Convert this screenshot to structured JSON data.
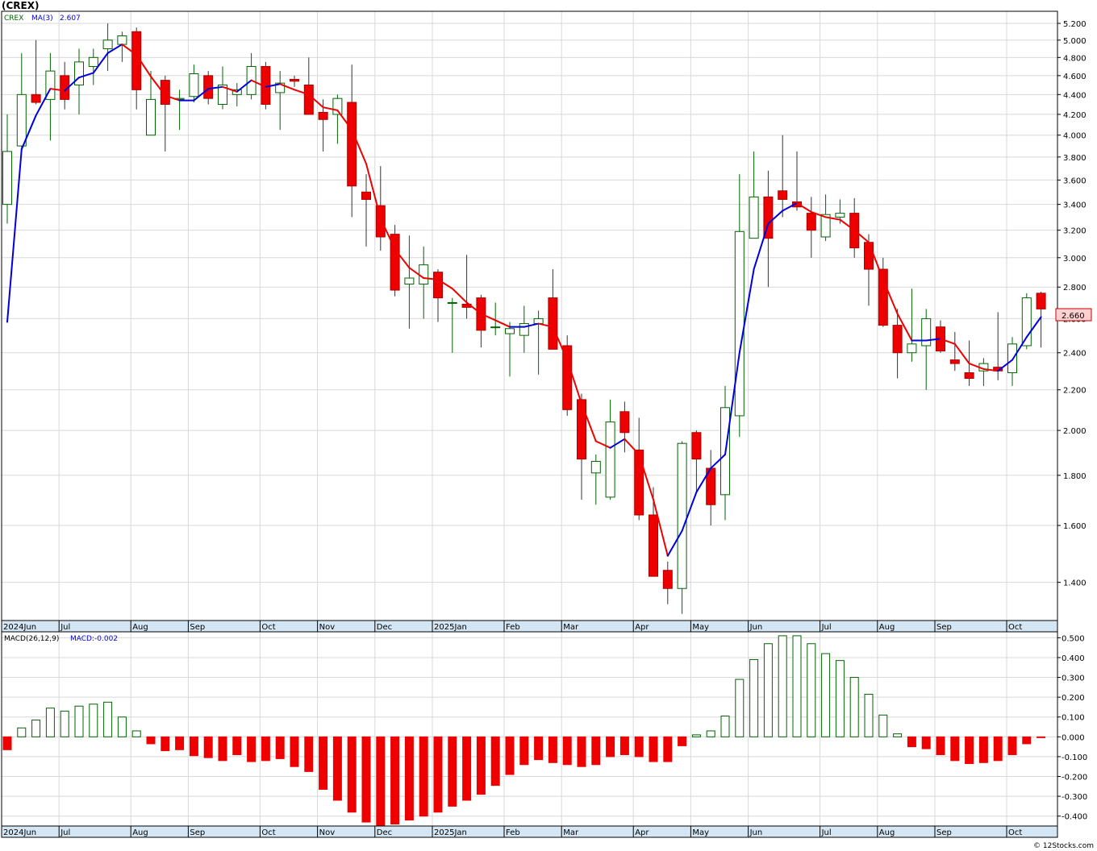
{
  "header": {
    "symbol_title": "(CREX)",
    "legend_symbol": "CREX",
    "legend_ma": "MA(3)",
    "legend_ma_value": "2.607",
    "macd_label": "MACD(26,12,9)",
    "macd_value_label": "MACD:-0.002",
    "watermark": "© 12Stocks.com",
    "last_price_tag": "2.660"
  },
  "colors": {
    "up_candle_fill": "#ffffff",
    "up_candle_stroke": "#006400",
    "down_candle_fill": "#ee0000",
    "down_candle_stroke": "#aa0000",
    "ma_rising": "#0000dd",
    "ma_falling": "#ee0000",
    "macd_positive": "#006400",
    "macd_negative": "#ee0000",
    "grid": "#d8d8d8",
    "axis_band": "#d4e6f4",
    "price_tag": "#ffd0d0"
  },
  "chart_data": [
    {
      "type": "candlestick",
      "title": "(CREX)",
      "scale": "log",
      "ylim": [
        1.28,
        5.35
      ],
      "yticks": [
        "1.400",
        "1.600",
        "1.800",
        "2.000",
        "2.200",
        "2.400",
        "2.600",
        "2.800",
        "3.000",
        "3.200",
        "3.400",
        "3.600",
        "3.800",
        "4.000",
        "4.200",
        "4.400",
        "4.600",
        "4.800",
        "5.000",
        "5.200"
      ],
      "xlabels": [
        {
          "label": "2024Jun",
          "i": 0
        },
        {
          "label": "Jul",
          "i": 4
        },
        {
          "label": "Aug",
          "i": 9
        },
        {
          "label": "Sep",
          "i": 13
        },
        {
          "label": "Oct",
          "i": 18
        },
        {
          "label": "Nov",
          "i": 22
        },
        {
          "label": "Dec",
          "i": 26
        },
        {
          "label": "2025Jan",
          "i": 30
        },
        {
          "label": "Feb",
          "i": 35
        },
        {
          "label": "Mar",
          "i": 39
        },
        {
          "label": "Apr",
          "i": 44
        },
        {
          "label": "May",
          "i": 48
        },
        {
          "label": "Jun",
          "i": 52
        },
        {
          "label": "Jul",
          "i": 57
        },
        {
          "label": "Aug",
          "i": 61
        },
        {
          "label": "Sep",
          "i": 65
        },
        {
          "label": "Oct",
          "i": 70
        }
      ],
      "ohlc": [
        [
          3.4,
          4.2,
          3.25,
          3.85
        ],
        [
          3.9,
          4.85,
          3.85,
          4.4
        ],
        [
          4.4,
          5.0,
          4.3,
          4.32
        ],
        [
          4.35,
          4.85,
          3.95,
          4.65
        ],
        [
          4.6,
          4.75,
          4.25,
          4.35
        ],
        [
          4.5,
          4.9,
          4.2,
          4.75
        ],
        [
          4.7,
          4.9,
          4.5,
          4.8
        ],
        [
          4.9,
          5.2,
          4.65,
          5.0
        ],
        [
          4.95,
          5.1,
          4.75,
          5.05
        ],
        [
          5.1,
          5.15,
          4.25,
          4.45
        ],
        [
          4.0,
          4.65,
          4.0,
          4.35
        ],
        [
          4.55,
          4.6,
          3.85,
          4.3
        ],
        [
          4.35,
          4.45,
          4.05,
          4.36
        ],
        [
          4.38,
          4.72,
          4.32,
          4.62
        ],
        [
          4.6,
          4.65,
          4.3,
          4.36
        ],
        [
          4.3,
          4.7,
          4.25,
          4.5
        ],
        [
          4.4,
          4.52,
          4.28,
          4.45
        ],
        [
          4.4,
          4.85,
          4.35,
          4.7
        ],
        [
          4.7,
          4.75,
          4.25,
          4.3
        ],
        [
          4.42,
          4.65,
          4.05,
          4.52
        ],
        [
          4.56,
          4.6,
          4.48,
          4.54
        ],
        [
          4.5,
          4.8,
          4.2,
          4.2
        ],
        [
          4.22,
          4.35,
          3.85,
          4.15
        ],
        [
          4.2,
          4.4,
          3.92,
          4.36
        ],
        [
          4.32,
          4.72,
          3.3,
          3.55
        ],
        [
          3.5,
          3.65,
          3.08,
          3.44
        ],
        [
          3.39,
          3.72,
          3.05,
          3.15
        ],
        [
          3.17,
          3.24,
          2.74,
          2.78
        ],
        [
          2.82,
          3.16,
          2.54,
          2.86
        ],
        [
          2.82,
          3.08,
          2.6,
          2.95
        ],
        [
          2.9,
          2.92,
          2.58,
          2.73
        ],
        [
          2.7,
          2.73,
          2.4,
          2.7
        ],
        [
          2.69,
          3.02,
          2.6,
          2.67
        ],
        [
          2.73,
          2.75,
          2.43,
          2.53
        ],
        [
          2.55,
          2.7,
          2.5,
          2.55
        ],
        [
          2.51,
          2.58,
          2.27,
          2.54
        ],
        [
          2.5,
          2.68,
          2.4,
          2.57
        ],
        [
          2.57,
          2.65,
          2.28,
          2.6
        ],
        [
          2.73,
          2.92,
          2.42,
          2.42
        ],
        [
          2.44,
          2.5,
          2.07,
          2.1
        ],
        [
          2.15,
          2.18,
          1.7,
          1.87
        ],
        [
          1.81,
          1.89,
          1.68,
          1.86
        ],
        [
          1.71,
          2.15,
          1.7,
          2.04
        ],
        [
          2.09,
          2.14,
          1.9,
          1.99
        ],
        [
          1.91,
          2.06,
          1.62,
          1.64
        ],
        [
          1.64,
          1.75,
          1.42,
          1.42
        ],
        [
          1.44,
          1.47,
          1.33,
          1.38
        ],
        [
          1.38,
          1.95,
          1.3,
          1.94
        ],
        [
          1.99,
          2.0,
          1.73,
          1.87
        ],
        [
          1.83,
          1.91,
          1.6,
          1.68
        ],
        [
          1.72,
          2.22,
          1.62,
          2.11
        ],
        [
          2.07,
          3.65,
          1.97,
          3.19
        ],
        [
          3.14,
          3.85,
          3.14,
          3.46
        ],
        [
          3.46,
          3.68,
          2.8,
          3.14
        ],
        [
          3.51,
          4.0,
          3.3,
          3.44
        ],
        [
          3.42,
          3.85,
          3.35,
          3.38
        ],
        [
          3.33,
          3.46,
          3.0,
          3.2
        ],
        [
          3.15,
          3.48,
          3.12,
          3.32
        ],
        [
          3.3,
          3.44,
          3.25,
          3.33
        ],
        [
          3.33,
          3.45,
          3.0,
          3.07
        ],
        [
          3.11,
          3.17,
          2.68,
          2.92
        ],
        [
          2.92,
          3.0,
          2.55,
          2.56
        ],
        [
          2.56,
          2.66,
          2.26,
          2.4
        ],
        [
          2.4,
          2.79,
          2.35,
          2.45
        ],
        [
          2.44,
          2.66,
          2.2,
          2.6
        ],
        [
          2.55,
          2.59,
          2.4,
          2.41
        ],
        [
          2.36,
          2.52,
          2.3,
          2.34
        ],
        [
          2.29,
          2.47,
          2.22,
          2.26
        ],
        [
          2.3,
          2.37,
          2.22,
          2.34
        ],
        [
          2.32,
          2.64,
          2.25,
          2.3
        ],
        [
          2.29,
          2.49,
          2.22,
          2.45
        ],
        [
          2.44,
          2.76,
          2.42,
          2.73
        ],
        [
          2.76,
          2.77,
          2.43,
          2.66
        ]
      ],
      "ma3": [
        2.58,
        3.87,
        4.19,
        4.46,
        4.44,
        4.58,
        4.63,
        4.85,
        4.95,
        4.83,
        4.59,
        4.39,
        4.34,
        4.34,
        4.46,
        4.48,
        4.43,
        4.55,
        4.48,
        4.51,
        4.45,
        4.4,
        4.27,
        4.24,
        4.05,
        3.74,
        3.29,
        3.06,
        2.93,
        2.86,
        2.85,
        2.79,
        2.7,
        2.63,
        2.59,
        2.55,
        2.55,
        2.57,
        2.55,
        2.36,
        2.13,
        1.95,
        1.92,
        1.96,
        1.89,
        1.7,
        1.49,
        1.58,
        1.73,
        1.83,
        1.89,
        2.4,
        2.92,
        3.25,
        3.35,
        3.41,
        3.34,
        3.3,
        3.28,
        3.2,
        3.11,
        2.85,
        2.63,
        2.47,
        2.47,
        2.48,
        2.45,
        2.34,
        2.31,
        2.3,
        2.36,
        2.49,
        2.61
      ]
    },
    {
      "type": "bar",
      "title": "MACD(26,12,9)",
      "ylim": [
        -0.45,
        0.53
      ],
      "yticks": [
        "-0.400",
        "-0.300",
        "-0.200",
        "-0.100",
        "0.000",
        "0.100",
        "0.200",
        "0.300",
        "0.400",
        "0.500"
      ],
      "values": [
        -0.065,
        0.045,
        0.085,
        0.145,
        0.13,
        0.155,
        0.165,
        0.175,
        0.1,
        0.03,
        -0.035,
        -0.07,
        -0.065,
        -0.095,
        -0.105,
        -0.12,
        -0.09,
        -0.125,
        -0.12,
        -0.11,
        -0.15,
        -0.175,
        -0.265,
        -0.32,
        -0.38,
        -0.43,
        -0.45,
        -0.44,
        -0.42,
        -0.4,
        -0.38,
        -0.35,
        -0.32,
        -0.29,
        -0.245,
        -0.19,
        -0.14,
        -0.115,
        -0.13,
        -0.14,
        -0.15,
        -0.14,
        -0.1,
        -0.09,
        -0.1,
        -0.125,
        -0.125,
        -0.045,
        0.01,
        0.03,
        0.105,
        0.29,
        0.39,
        0.47,
        0.51,
        0.51,
        0.47,
        0.42,
        0.385,
        0.3,
        0.215,
        0.11,
        0.015,
        -0.05,
        -0.06,
        -0.09,
        -0.12,
        -0.135,
        -0.13,
        -0.12,
        -0.09,
        -0.035,
        -0.002
      ]
    }
  ]
}
